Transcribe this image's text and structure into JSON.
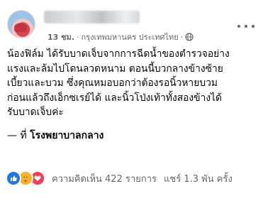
{
  "post": {
    "author": {
      "avatar_icon": "profile-avatar"
    },
    "time": "13 ชม.",
    "separator": " · ",
    "place": "กรุงเทพมหานคร ประเทศไทย",
    "separator2": " · ",
    "audience_icon": "globe-icon",
    "text_lines": [
      "น้องฟิล์ม ได้รับบาดเจ็บจากการฉีดน้ำของตำรวจอย่าง",
      "แรงและล้มไปโดนลวดหนาม ตอนนี้บวกลางข้างซ้าย",
      "เบี้ยวและบวม ซึ่งคุณหมอบอกว่าต้องรอนิ้วหายบวม",
      "ก่อนแล้วถึงเอ็กซเรย์ได้ และนิ้วโป่งเท้าทั้งสองข้างได้",
      "รับบาดเจ็บค่ะ"
    ],
    "location_prefix": "— ที่ ",
    "location_name": "โรงพยาบาลกลาง"
  },
  "stats": {
    "reaction_icons": [
      "like-icon",
      "care-icon",
      "love-icon"
    ],
    "comments": "ความคิดเห็น 422 รายการ",
    "shares": "แชร์ 1.3 พัน ครั้ง"
  },
  "colors": {
    "like": "#1877f2",
    "care": "#f7b125",
    "love": "#f33e58",
    "secondary_text": "#65676b"
  }
}
